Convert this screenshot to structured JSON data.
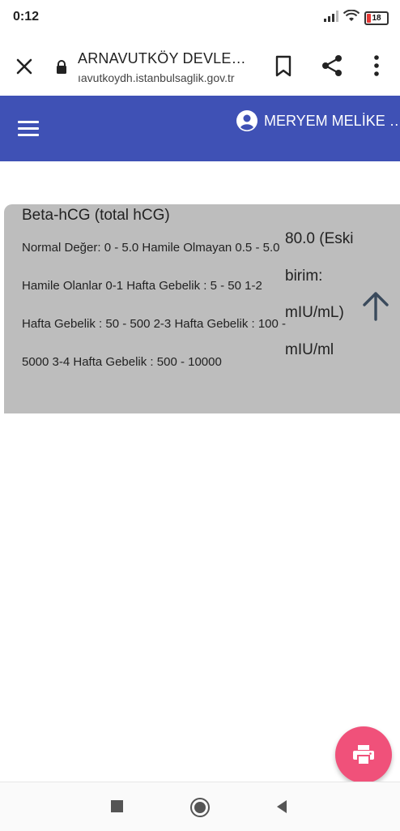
{
  "status_bar": {
    "time": "0:12",
    "battery_level": "18",
    "icons": [
      "signal-icon",
      "wifi-icon",
      "battery-icon"
    ]
  },
  "browser": {
    "title": "ARNAVUTKÖY DEVLE…",
    "url": "ıavutkoydh.istanbulsaglik.gov.tr",
    "icons": [
      "close-icon",
      "lock-icon",
      "bookmark-icon",
      "share-icon",
      "more-vert-icon"
    ]
  },
  "app_bar": {
    "user_name": "MERYEM MELİKE …",
    "color": "#3f51b5",
    "icons": [
      "menu-icon",
      "account-circle-icon"
    ]
  },
  "result": {
    "test_name": "Beta-hCG (total hCG)",
    "reference_range": "Normal Değer: 0 - 5.0 Hamile Olmayan 0.5 - 5.0 Hamile Olanlar 0-1 Hafta Gebelik : 5 - 50 1-2 Hafta Gebelik : 50 - 500 2-3 Hafta Gebelik : 100 - 5000 3-4 Hafta Gebelik : 500 - 10000",
    "value": "80.0 (Eski birim: mIU/mL) mIU/ml",
    "card_color": "#bdbdbd",
    "trend_icon": "arrow-up-icon"
  },
  "fab": {
    "icon": "print-icon",
    "color": "#f0517a"
  },
  "nav_bar": {
    "icons": [
      "recents-square-icon",
      "home-circle-icon",
      "back-triangle-icon"
    ]
  }
}
